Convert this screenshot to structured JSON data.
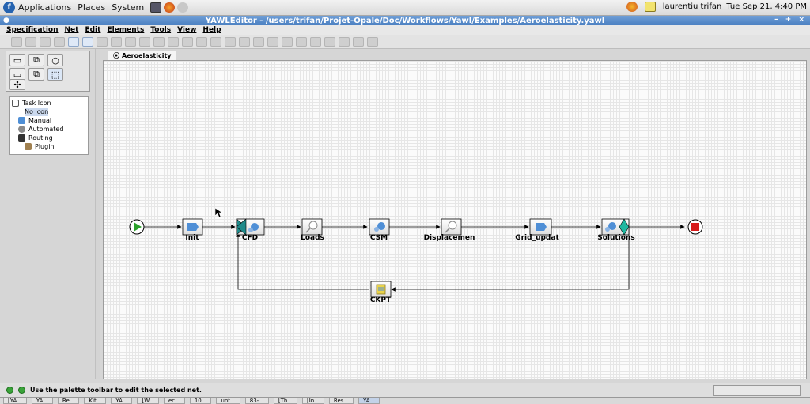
{
  "panel": {
    "menus": [
      "Applications",
      "Places",
      "System"
    ],
    "user": "laurentiu trifan",
    "datetime": "Tue Sep 21,  4:40 PM"
  },
  "window": {
    "title": "YAWLEditor - /users/trifan/Projet-Opale/Doc/Workflows/Yawl/Examples/Aeroelasticity.yawl"
  },
  "menubar": [
    "Specification",
    "Net",
    "Edit",
    "Elements",
    "Tools",
    "View",
    "Help"
  ],
  "task_tree": {
    "header": "Task Icon",
    "items": [
      "No Icon",
      "Manual",
      "Automated",
      "Routing",
      "Plugin"
    ]
  },
  "net_tab": "Aeroelasticity",
  "net": {
    "tasks": [
      "Init",
      "CFD",
      "Loads",
      "CSM",
      "Displacemen",
      "Grid_updat",
      "Solutions",
      "CKPT"
    ]
  },
  "status": "Use the palette toolbar to edit the selected net.",
  "taskbar": [
    "[YA...",
    "YA...",
    "Re...",
    "Kit...",
    "YA...",
    "[W...",
    "ec...",
    "10...",
    "unt...",
    "83-...",
    "[Th...",
    "[In...",
    "Res...",
    "YA..."
  ],
  "colors": {
    "title_bar": "#4a7fc1",
    "start_condition": "#2aa12a",
    "end_condition": "#d81c1c",
    "task_blue": "#4f8fd6"
  }
}
